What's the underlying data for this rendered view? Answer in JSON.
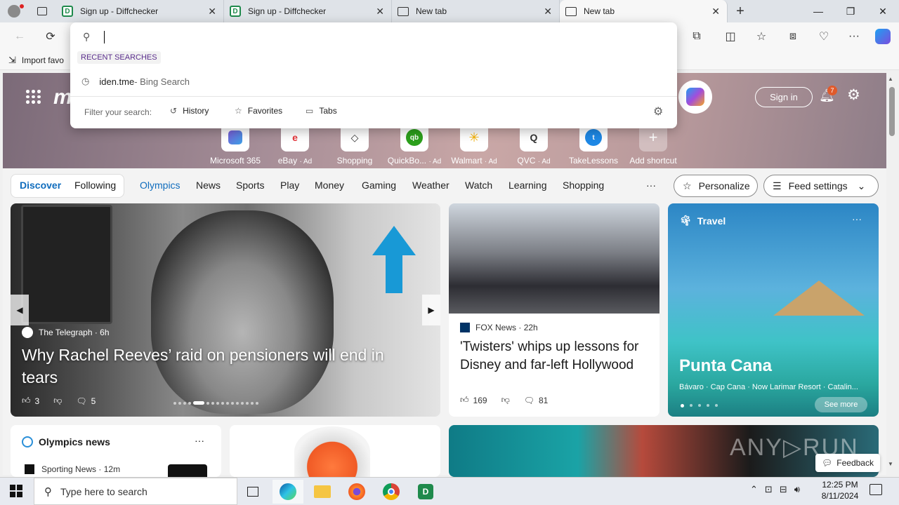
{
  "tabs": [
    {
      "title": "Sign up - Diffchecker",
      "icon": "diffchecker-icon"
    },
    {
      "title": "Sign up - Diffchecker",
      "icon": "diffchecker-icon"
    },
    {
      "title": "New tab",
      "icon": "newtab-icon"
    },
    {
      "title": "New tab",
      "icon": "newtab-icon",
      "active": true
    }
  ],
  "favorites_bar": {
    "import_label": "Import favo"
  },
  "address_dropdown": {
    "recent_header": "RECENT SEARCHES",
    "recent_items": [
      {
        "query": "iden.tme",
        "suffix": " - Bing Search"
      }
    ],
    "filter_label": "Filter your search:",
    "filters": [
      "History",
      "Favorites",
      "Tabs"
    ]
  },
  "header": {
    "sign_in": "Sign in",
    "notification_count": "7"
  },
  "shortcuts": [
    {
      "label": "Microsoft 365",
      "ad": ""
    },
    {
      "label": "eBay",
      "ad": "· Ad"
    },
    {
      "label": "Shopping",
      "ad": ""
    },
    {
      "label": "QuickBo...",
      "ad": "· Ad"
    },
    {
      "label": "Walmart",
      "ad": "· Ad"
    },
    {
      "label": "QVC",
      "ad": "· Ad"
    },
    {
      "label": "TakeLessons",
      "ad": ""
    },
    {
      "label": "Add shortcut",
      "ad": ""
    }
  ],
  "nav": {
    "discover": "Discover",
    "following": "Following",
    "items": [
      "Olympics",
      "News",
      "Sports",
      "Play",
      "Money",
      "Gaming",
      "Weather",
      "Watch",
      "Learning",
      "Shopping"
    ],
    "more": "···",
    "personalize": "Personalize",
    "feed_settings": "Feed settings"
  },
  "cards": {
    "main": {
      "source": "The Telegraph",
      "age": "· 6h",
      "headline": "Why Rachel Reeves’ raid on pensioners will end in tears",
      "likes": "3",
      "comments": "5"
    },
    "twisters": {
      "source": "FOX News",
      "age": "· 22h",
      "headline": "'Twisters' whips up lessons for Disney and far-left Hollywood",
      "likes": "169",
      "comments": "81"
    },
    "travel": {
      "category": "Travel",
      "title": "Punta Cana",
      "subtitle": "Bávaro · Cap Cana · Now Larimar Resort · Catalin...",
      "see_more": "See more"
    },
    "olympics": {
      "title": "Olympics news",
      "source": "Sporting News",
      "age": "· 12m"
    }
  },
  "feedback": "Feedback",
  "taskbar": {
    "search_placeholder": "Type here to search",
    "time": "12:25 PM",
    "date": "8/11/2024"
  }
}
